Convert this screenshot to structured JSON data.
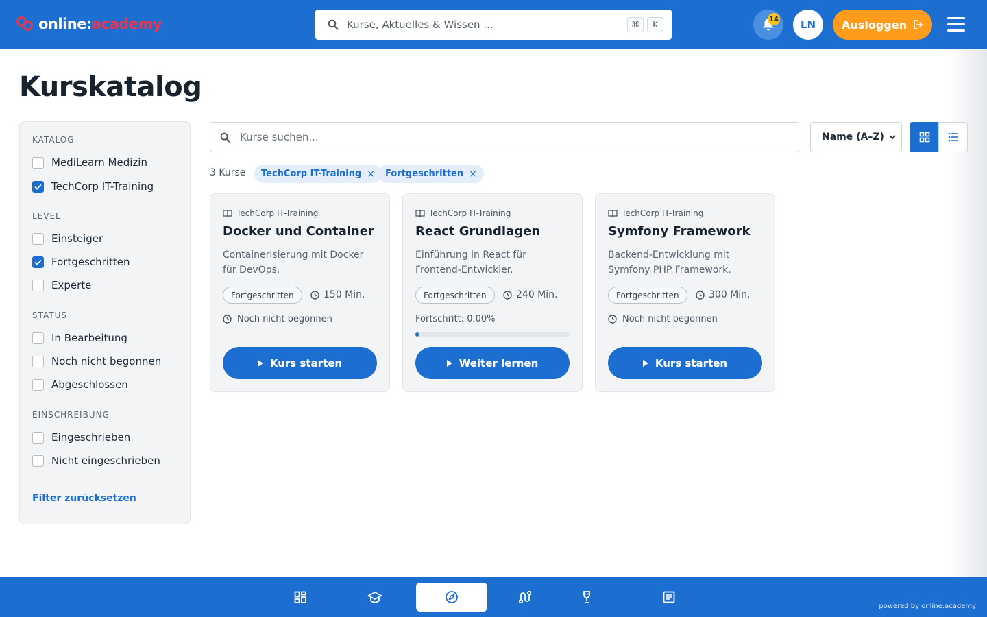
{
  "header": {
    "logo_part1": "online:",
    "logo_part2": "academy",
    "search_placeholder": "Kurse, Aktuelles & Wissen ...",
    "kbd_cmd": "⌘",
    "kbd_key": "K",
    "notification_count": "14",
    "avatar_initials": "LN",
    "logout_label": "Ausloggen"
  },
  "page": {
    "title": "Kurskatalog"
  },
  "sidebar": {
    "sections": [
      {
        "title": "KATALOG",
        "options": [
          {
            "label": "MediLearn Medizin",
            "checked": false
          },
          {
            "label": "TechCorp IT-Training",
            "checked": true
          }
        ]
      },
      {
        "title": "LEVEL",
        "options": [
          {
            "label": "Einsteiger",
            "checked": false
          },
          {
            "label": "Fortgeschritten",
            "checked": true
          },
          {
            "label": "Experte",
            "checked": false
          }
        ]
      },
      {
        "title": "STATUS",
        "options": [
          {
            "label": "In Bearbeitung",
            "checked": false
          },
          {
            "label": "Noch nicht begonnen",
            "checked": false
          },
          {
            "label": "Abgeschlossen",
            "checked": false
          }
        ]
      },
      {
        "title": "EINSCHREIBUNG",
        "options": [
          {
            "label": "Eingeschrieben",
            "checked": false
          },
          {
            "label": "Nicht eingeschrieben",
            "checked": false
          }
        ]
      }
    ],
    "reset_label": "Filter zurücksetzen"
  },
  "toolbar": {
    "search_placeholder": "Kurse suchen...",
    "sort_value": "Name (A–Z)",
    "result_count": "3 Kurse",
    "chips": [
      "TechCorp IT-Training",
      "Fortgeschritten"
    ],
    "chip_remove": "×"
  },
  "courses": [
    {
      "catalog": "TechCorp IT-Training",
      "title": "Docker und Container",
      "description": "Containerisierung mit Docker für DevOps.",
      "level": "Fortgeschritten",
      "duration": "150 Min.",
      "status": "Noch nicht begonnen",
      "button": "Kurs starten"
    },
    {
      "catalog": "TechCorp IT-Training",
      "title": "React Grundlagen",
      "description": "Einführung in React für Frontend-Entwickler.",
      "level": "Fortgeschritten",
      "duration": "240 Min.",
      "progress_label": "Fortschritt: 0.00%",
      "progress": 0.02,
      "button": "Weiter lernen"
    },
    {
      "catalog": "TechCorp IT-Training",
      "title": "Symfony Framework",
      "description": "Backend-Entwicklung mit Symfony PHP Framework.",
      "level": "Fortgeschritten",
      "duration": "300 Min.",
      "status": "Noch nicht begonnen",
      "button": "Kurs starten"
    }
  ],
  "bottom_nav": {
    "items": [
      "dashboard-icon",
      "graduation-cap-icon",
      "compass-icon",
      "route-icon",
      "trophy-icon",
      "article-icon"
    ],
    "active": 2
  },
  "footer": {
    "powered": "powered by online:academy"
  },
  "colors": {
    "primary": "#1c6fd1",
    "accent": "#ff9c1b",
    "brand_red": "#e8364f",
    "badge": "#ffc21a"
  }
}
